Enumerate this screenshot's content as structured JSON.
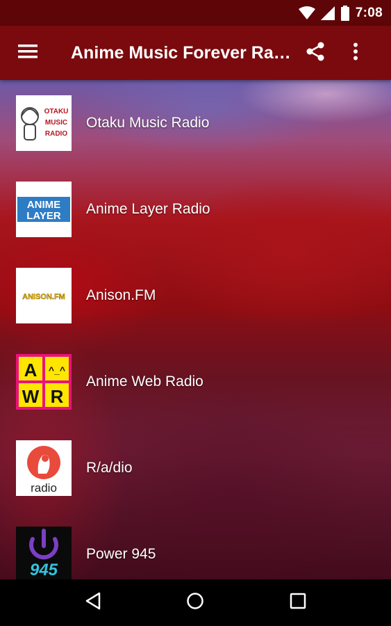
{
  "status_bar": {
    "time": "7:08",
    "icons": [
      "wifi-icon",
      "signal-icon",
      "battery-icon"
    ]
  },
  "app_bar": {
    "title": "Anime Music Forever Radio",
    "menu_icon": "hamburger-menu-icon",
    "actions": [
      "share-icon",
      "more-vert-icon"
    ]
  },
  "stations": [
    {
      "name": "Otaku Music Radio",
      "logo_text": [
        "OTAKU",
        "MUSIC",
        "RADIO"
      ]
    },
    {
      "name": "Anime Layer Radio",
      "logo_text": [
        "ANIME",
        "LAYER"
      ]
    },
    {
      "name": "Anison.FM",
      "logo_text": [
        "ANISON.FM"
      ]
    },
    {
      "name": "Anime Web Radio",
      "logo_text": [
        "A",
        "^_^",
        "W",
        "R"
      ]
    },
    {
      "name": "R/a/dio",
      "logo_text": [
        "radio"
      ]
    },
    {
      "name": "Power 945",
      "logo_text": [
        "945"
      ]
    }
  ],
  "nav_bar": {
    "buttons": [
      "back-icon",
      "home-icon",
      "recents-icon"
    ]
  },
  "colors": {
    "status_bar": "#5e0507",
    "app_bar": "#7a0a0e",
    "text": "#ffffff"
  }
}
